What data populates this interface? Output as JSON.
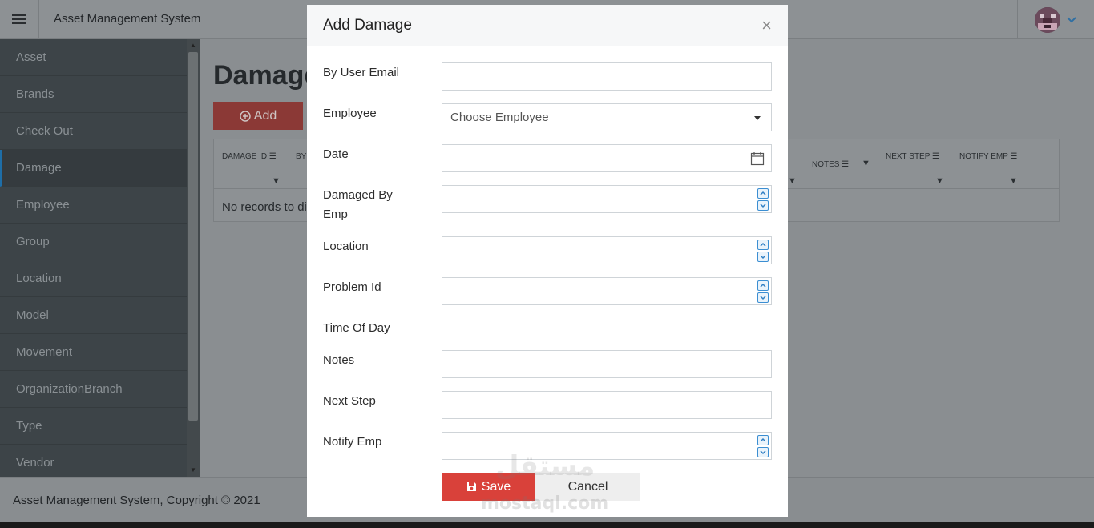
{
  "app": {
    "title": "Asset Management System"
  },
  "sidebar": {
    "items": [
      {
        "label": "Asset"
      },
      {
        "label": "Brands"
      },
      {
        "label": "Check Out"
      },
      {
        "label": "Damage",
        "active": true
      },
      {
        "label": "Employee"
      },
      {
        "label": "Group"
      },
      {
        "label": "Location"
      },
      {
        "label": "Model"
      },
      {
        "label": "Movement"
      },
      {
        "label": "OrganizationBranch"
      },
      {
        "label": "Type"
      },
      {
        "label": "Vendor"
      }
    ]
  },
  "main": {
    "title": "Damage",
    "add_label": "Add",
    "columns": [
      "DAMAGE ID",
      "BY",
      "NOTES",
      "NEXT STEP",
      "NOTIFY EMP"
    ],
    "empty_text": "No records to di"
  },
  "footer": {
    "text": "Asset Management System, Copyright © 2021"
  },
  "modal": {
    "title": "Add Damage",
    "close_symbol": "×",
    "fields": {
      "by_user_email": {
        "label": "By User Email",
        "value": ""
      },
      "employee": {
        "label": "Employee",
        "placeholder": "Choose Employee"
      },
      "date": {
        "label": "Date",
        "value": ""
      },
      "damaged_by_emp": {
        "label": "Damaged By Emp",
        "value": ""
      },
      "location": {
        "label": "Location",
        "value": ""
      },
      "problem_id": {
        "label": "Problem Id",
        "value": ""
      },
      "time_of_day": {
        "label": "Time Of Day"
      },
      "notes": {
        "label": "Notes",
        "value": ""
      },
      "next_step": {
        "label": "Next Step",
        "value": ""
      },
      "notify_emp": {
        "label": "Notify Emp",
        "value": ""
      }
    },
    "save_label": "Save",
    "cancel_label": "Cancel"
  },
  "watermark": {
    "arabic": "مستقل",
    "latin": "mostaql.com"
  },
  "colors": {
    "save_button": "#d9413a",
    "sidebar_active_border": "#1e6ea8",
    "spinner_accent": "#3b8ed2"
  }
}
